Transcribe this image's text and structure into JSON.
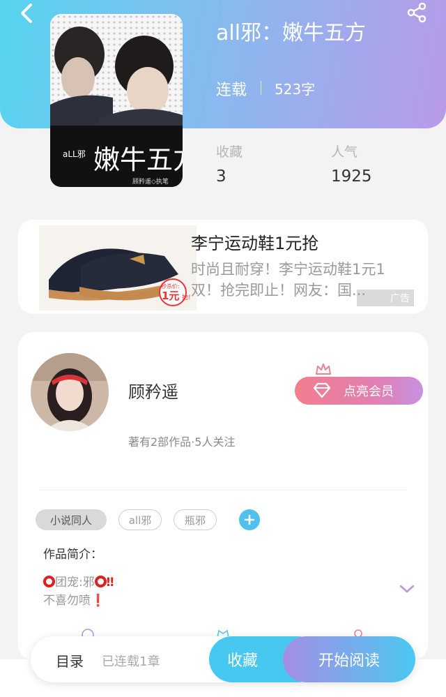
{
  "header": {
    "back_icon": "chevron-left-icon",
    "share_icon": "share-icon"
  },
  "book": {
    "title": "all邪：嫩牛五方",
    "status": "连载",
    "word_count": "523字",
    "stats": [
      {
        "label": "收藏",
        "value": "3"
      },
      {
        "label": "人气",
        "value": "1925"
      }
    ],
    "cover": {
      "brand": "aLL邪",
      "title_art": "嫩牛五方",
      "credit": "顾矜遥◇执笔"
    }
  },
  "ad": {
    "title": "李宁运动鞋1元抢",
    "description": "时尚且耐穿！李宁运动鞋1元1双！抢完即止！网友：国...",
    "tag": "广告",
    "price_label": "秒杀价:",
    "price": "1元",
    "price_suffix": "抢!"
  },
  "author": {
    "name": "顾矜遥",
    "meta": "著有2部作品·5人关注",
    "vip_button": "点亮会员"
  },
  "tags": [
    "小说同人",
    "all邪",
    "瓶邪"
  ],
  "intro": {
    "label": "作品简介：",
    "line1_text": "团宠:邪",
    "line1_mark": "‼",
    "line2_text": "不喜勿喷",
    "line2_mark": "❗"
  },
  "bottom_bar": {
    "toc_label": "目录",
    "toc_count": "已连载1章",
    "favorite_button": "收藏",
    "read_button": "开始阅读"
  },
  "colors": {
    "accent_blue": "#47c8f1",
    "accent_purple": "#b89ae9",
    "vip_pink": "#f27e8e"
  }
}
